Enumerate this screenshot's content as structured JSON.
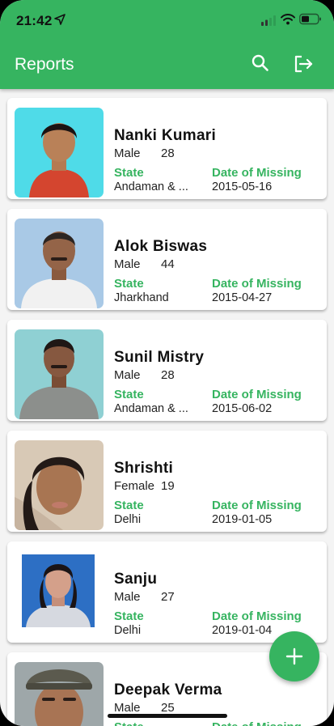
{
  "status_bar": {
    "time": "21:42"
  },
  "app_bar": {
    "title": "Reports"
  },
  "labels": {
    "state": "State",
    "date_of_missing": "Date of Missing"
  },
  "reports": [
    {
      "name": "Nanki Kumari",
      "gender": "Male",
      "age": "28",
      "state": "Andaman & ...",
      "date": "2015-05-16",
      "photo_bg": "#4fdbe8"
    },
    {
      "name": "Alok Biswas",
      "gender": "Male",
      "age": "44",
      "state": "Jharkhand",
      "date": "2015-04-27",
      "photo_bg": "#a9c9e6"
    },
    {
      "name": "Sunil Mistry",
      "gender": "Male",
      "age": "28",
      "state": "Andaman & ...",
      "date": "2015-06-02",
      "photo_bg": "#8fd0d3"
    },
    {
      "name": "Shrishti",
      "gender": "Female",
      "age": "19",
      "state": "Delhi",
      "date": "2019-01-05",
      "photo_bg": "#d8c9b6"
    },
    {
      "name": "Sanju",
      "gender": "Male",
      "age": "27",
      "state": "Delhi",
      "date": "2019-01-04",
      "photo_bg": "#2d6fc4"
    },
    {
      "name": "Deepak Verma",
      "gender": "Male",
      "age": "25",
      "state": "",
      "date": "",
      "photo_bg": "#9ea7a9"
    }
  ],
  "colors": {
    "accent": "#36b460",
    "background": "#f4f4f4",
    "card": "#ffffff"
  },
  "icons": {
    "search": "search-icon",
    "logout": "logout-icon",
    "add": "plus-icon"
  }
}
